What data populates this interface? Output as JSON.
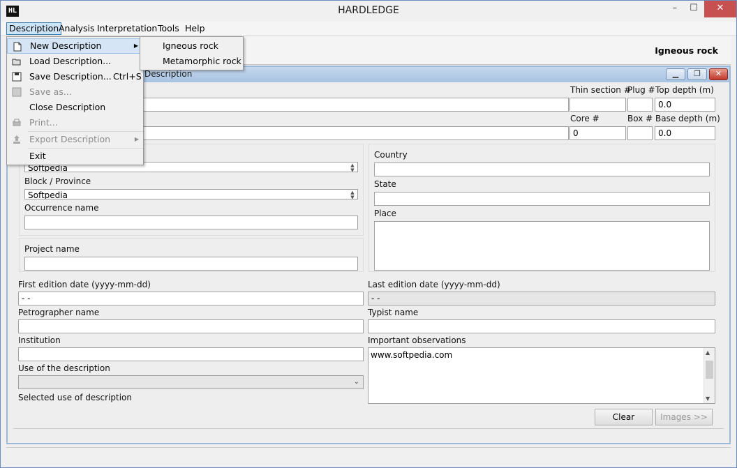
{
  "window": {
    "app_icon": "HL",
    "title": "HARDLEDGE",
    "minimize": "–",
    "maximize": "☐",
    "close": "✕"
  },
  "menubar": [
    "Description",
    "Analysis",
    "Interpretation",
    "Tools",
    "Help"
  ],
  "toolbar": {
    "rock_type": "Igneous rock"
  },
  "internal_frame": {
    "title": "Description"
  },
  "description_menu": {
    "new": "New Description",
    "load": "Load Description...",
    "save": "Save Description...",
    "save_accel": "Ctrl+S",
    "save_as": "Save as...",
    "close": "Close Description",
    "print": "Print...",
    "export": "Export Description",
    "exit": "Exit"
  },
  "new_submenu": {
    "igneous": "Igneous rock",
    "metamorphic": "Metamorphic rock"
  },
  "form": {
    "thin_section_label": "Thin section #",
    "plug_label": "Plug #",
    "top_depth_label": "Top depth (m)",
    "top_depth_value": "0.0",
    "core_label": "Core #",
    "core_value": "0",
    "box_label": "Box #",
    "base_depth_label": "Base depth (m)",
    "base_depth_value": "0.0",
    "field_value": "Softpedia",
    "block_label": "Block / Province",
    "block_value": "Softpedia",
    "occurrence_label": "Occurrence name",
    "country_label": "Country",
    "state_label": "State",
    "place_label": "Place",
    "project_label": "Project name",
    "first_edition_label": "First edition date (yyyy-mm-dd)",
    "first_edition_value": "  -  -",
    "last_edition_label": "Last edition date (yyyy-mm-dd)",
    "last_edition_value": "  -  -",
    "petrographer_label": "Petrographer name",
    "typist_label": "Typist name",
    "institution_label": "Institution",
    "observations_label": "Important observations",
    "observations_value": "www.softpedia.com",
    "use_label": "Use of the description",
    "selected_use_label": "Selected use of description",
    "clear_button": "Clear",
    "images_button": "Images >>"
  }
}
